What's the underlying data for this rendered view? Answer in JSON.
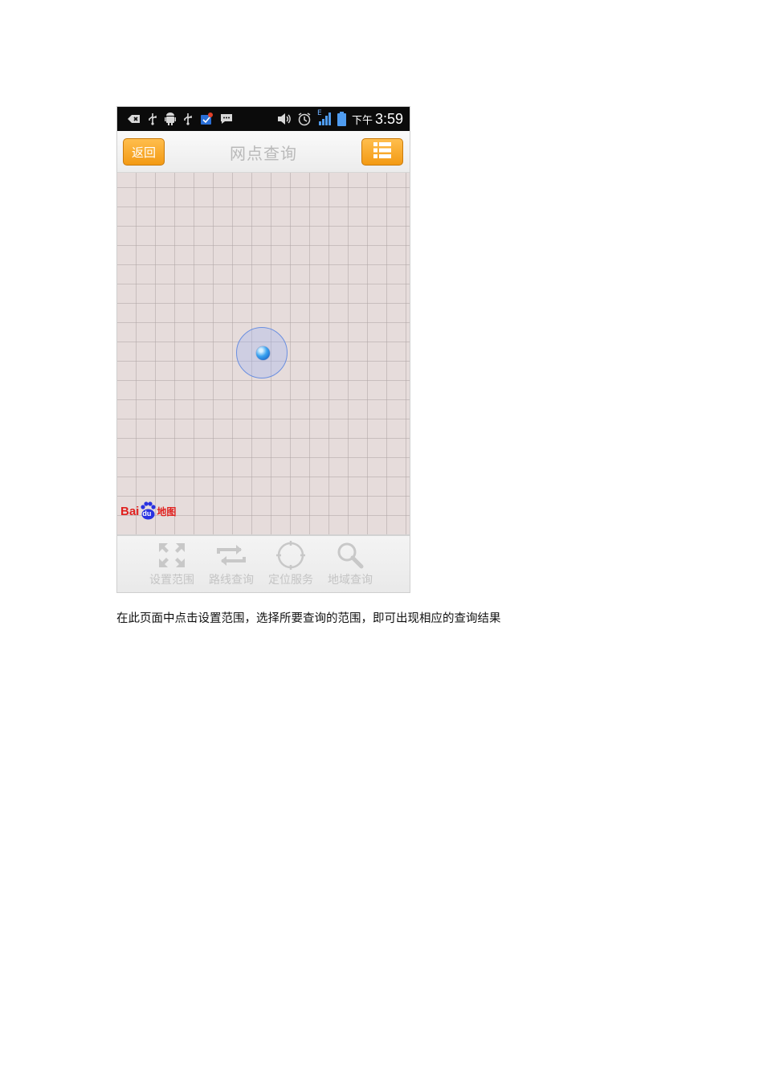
{
  "status_bar": {
    "ampm": "下午",
    "time": "3:59",
    "network_label": "E",
    "icons": [
      "back-icon",
      "usb-icon",
      "android-icon",
      "usb-icon",
      "notification-icon",
      "message-icon",
      "volume-icon",
      "alarm-icon",
      "signal-icon",
      "battery-icon"
    ]
  },
  "header": {
    "back_label": "返回",
    "title": "网点查询",
    "menu_icon": "list-menu-icon"
  },
  "map": {
    "logo_text": "Bai",
    "logo_paw_text": "du",
    "logo_map_text": "地图"
  },
  "bottom_nav": {
    "items": [
      {
        "label": "设置范围",
        "icon": "expand-arrows-icon"
      },
      {
        "label": "路线查询",
        "icon": "route-loop-icon"
      },
      {
        "label": "定位服务",
        "icon": "locate-crosshair-icon"
      },
      {
        "label": "地域查询",
        "icon": "search-icon"
      }
    ]
  },
  "caption": "在此页面中点击设置范围，选择所要查询的范围，即可出现相应的查询结果",
  "colors": {
    "accent": "#f7a82a",
    "map_bg": "#e6dcdb",
    "status_bg": "#0b0b0b",
    "nav_label": "#c4c4c4",
    "baidu_red": "#e0211f",
    "baidu_blue": "#2932e1"
  }
}
